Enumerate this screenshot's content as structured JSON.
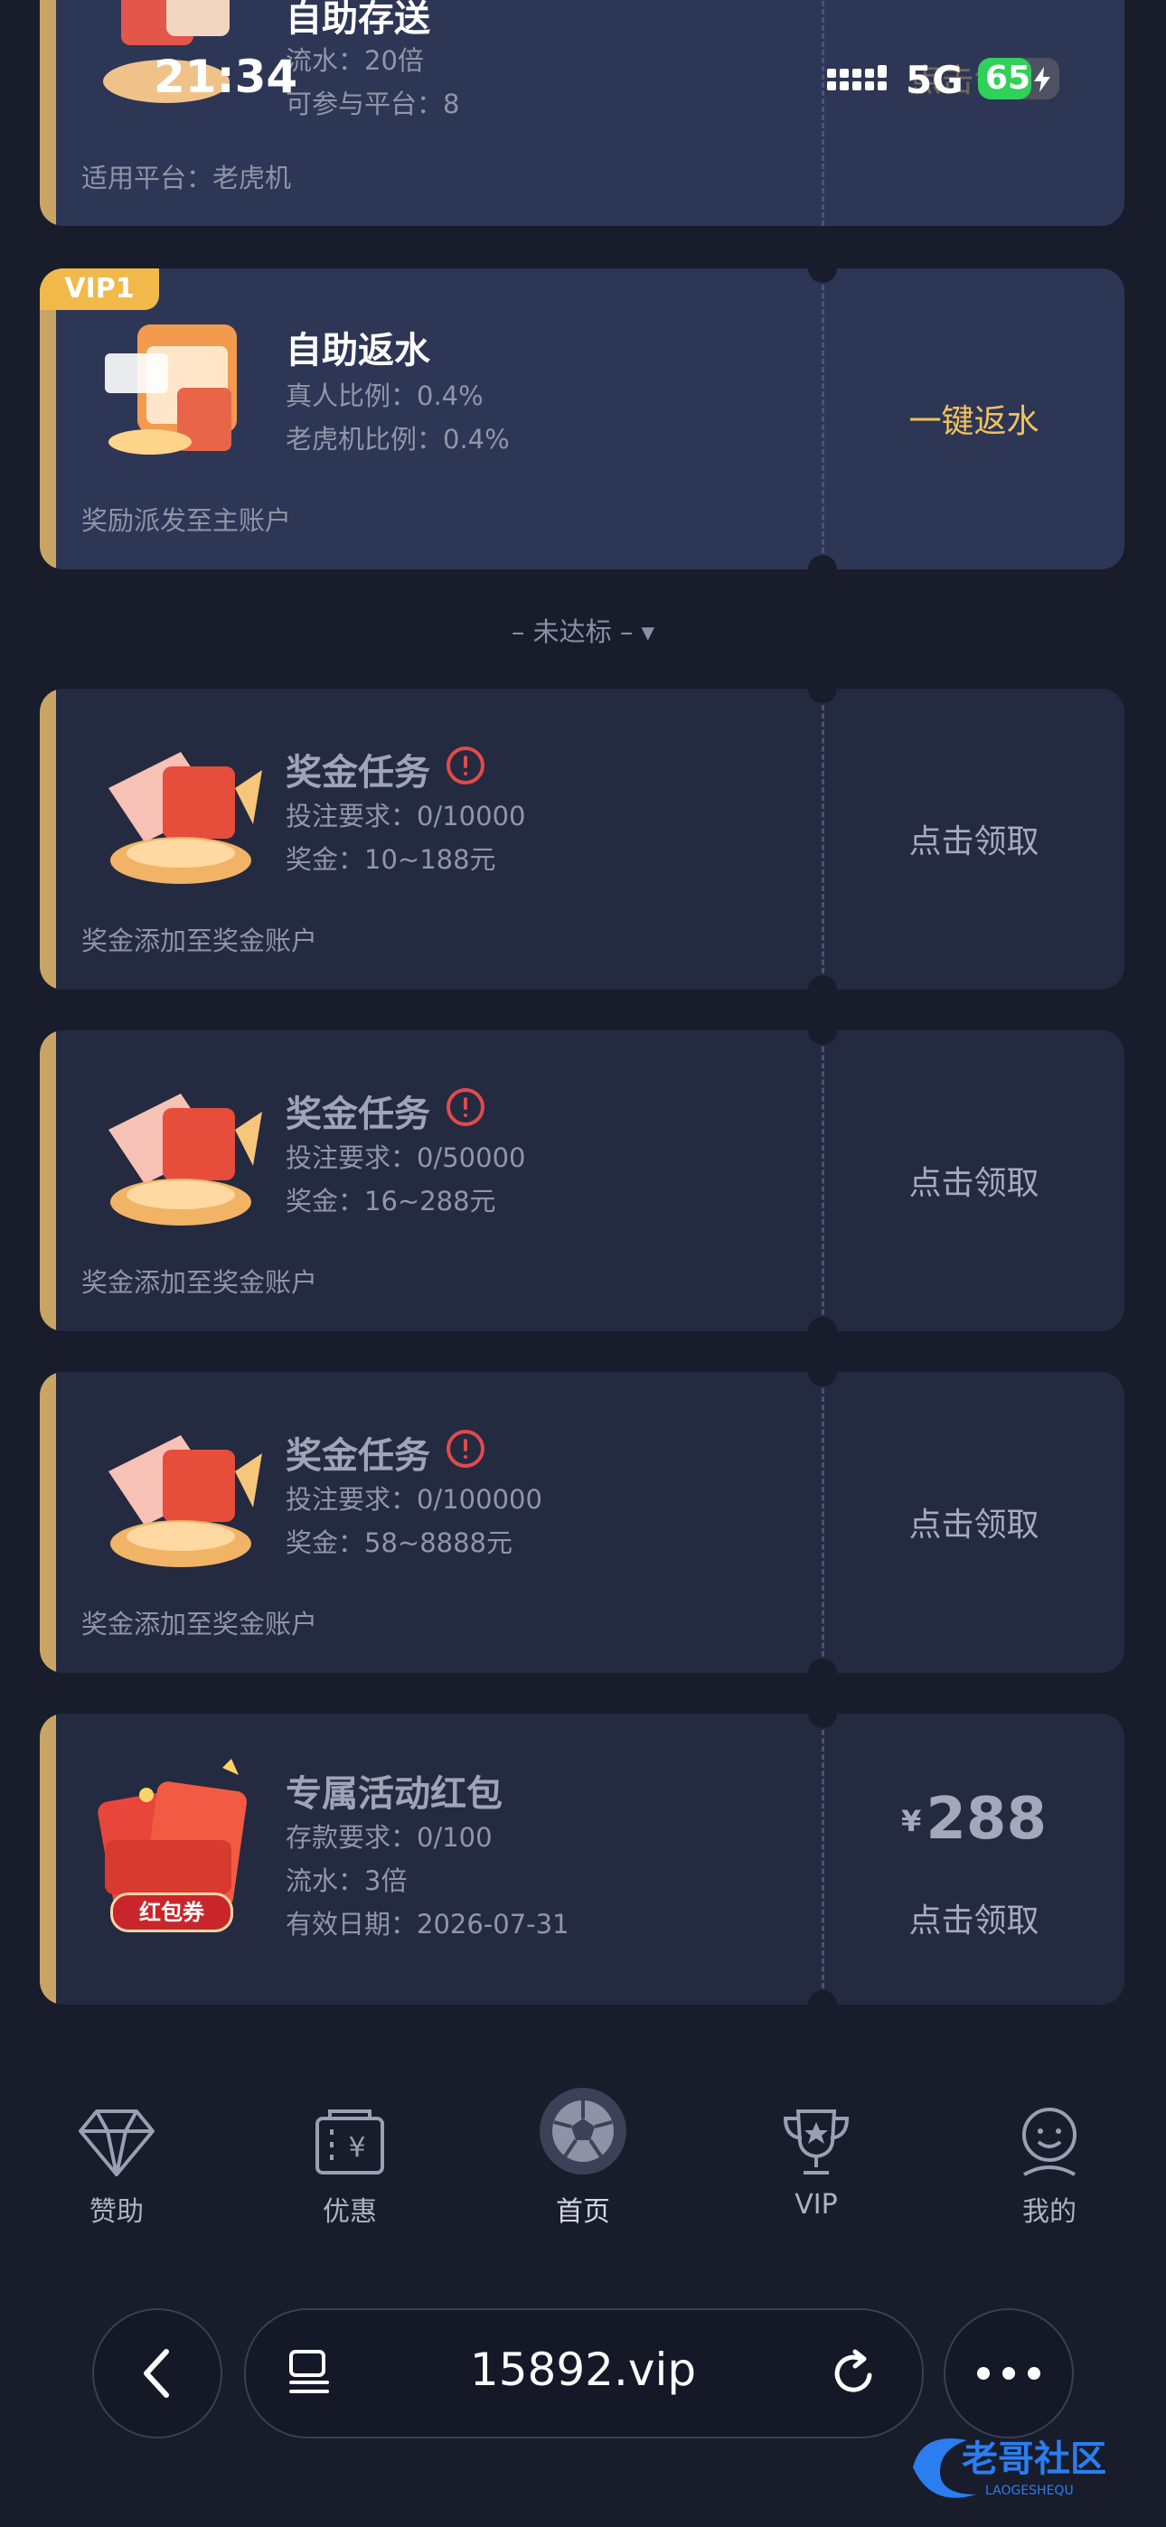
{
  "status_bar": {
    "time": "21:34",
    "network": "5G",
    "battery": "65",
    "battery_level": 0.65
  },
  "cards": [
    {
      "title": "自助存送",
      "lines": [
        "流水：20倍",
        "可参与平台：8"
      ],
      "footer": "适用平台：老虎机",
      "action": "点击领取"
    },
    {
      "badge": "VIP1",
      "title": "自助返水",
      "lines": [
        "真人比例：0.4%",
        "老虎机比例：0.4%"
      ],
      "footer": "奖励派发至主账户",
      "action": "一键返水"
    },
    {
      "title": "奖金任务",
      "lines": [
        "投注要求：0/10000",
        "奖金：10~188元"
      ],
      "footer": "奖金添加至奖金账户",
      "action": "点击领取"
    },
    {
      "title": "奖金任务",
      "lines": [
        "投注要求：0/50000",
        "奖金：16~288元"
      ],
      "footer": "奖金添加至奖金账户",
      "action": "点击领取"
    },
    {
      "title": "奖金任务",
      "lines": [
        "投注要求：0/100000",
        "奖金：58~8888元"
      ],
      "footer": "奖金添加至奖金账户",
      "action": "点击领取"
    },
    {
      "title": "专属活动红包",
      "lines": [
        "存款要求：0/100",
        "流水：3倍",
        "有效日期：2026-07-31"
      ],
      "currency": "¥",
      "amount": "288",
      "coupon_label": "红包券",
      "action": "点击领取"
    }
  ],
  "separator": "– 未达标 – ▾",
  "tabbar": [
    {
      "label": "赞助",
      "icon": "diamond-icon"
    },
    {
      "label": "优惠",
      "icon": "coupon-icon"
    },
    {
      "label": "首页",
      "icon": "soccer-ball-icon"
    },
    {
      "label": "VIP",
      "icon": "trophy-icon"
    },
    {
      "label": "我的",
      "icon": "profile-icon"
    }
  ],
  "browser": {
    "url": "15892.vip"
  },
  "watermark": {
    "text": "老哥社区",
    "subtext": "LAOGESHEQU"
  },
  "colors": {
    "accent_gold": "#c8a564",
    "action_gold": "#f2c25a",
    "vip_badge": "#f1b94a",
    "warn_red": "#e04b4b",
    "background": "#181c2b"
  }
}
